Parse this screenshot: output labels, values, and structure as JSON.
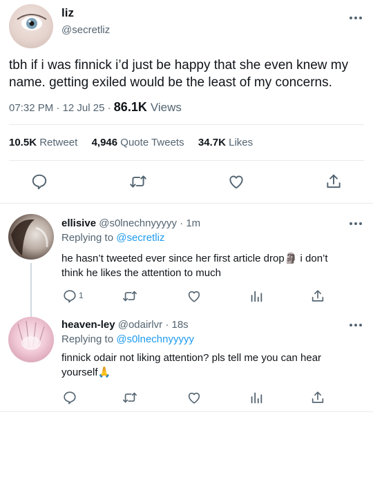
{
  "main_tweet": {
    "display_name": "liz",
    "handle": "@secretliz",
    "text_line1": "tbh if i was finnick i’d just be happy that she even knew my",
    "text_line2": "name. getting exiled would be the least of my concerns.",
    "time": "07:32 PM",
    "date": "12 Jul 25",
    "views_count": "86.1K",
    "views_label": "Views",
    "retweets_count": "10.5K",
    "retweets_label": "Retweet",
    "quotes_count": "4,946",
    "quotes_label": "Quote Tweets",
    "likes_count": "34.7K",
    "likes_label": "Likes"
  },
  "replies": [
    {
      "display_name": "ellisive",
      "handle": "@s0lnechnyyyyy",
      "time": "1m",
      "replying_label": "Replying to",
      "replying_to": "@secretliz",
      "text_line1": "he hasn’t tweeted ever since her first article drop🗿  i don’t",
      "text_line2": "think he likes the attention to much",
      "reply_count": "1"
    },
    {
      "display_name": "heaven-ley",
      "handle": "@odairlvr",
      "time": "18s",
      "replying_label": "Replying to",
      "replying_to": "@s0lnechnyyyyy",
      "text_line1": "finnick odair not liking attention? pls tell me you can hear",
      "text_line2": "yourself🙏",
      "reply_count": ""
    }
  ],
  "icons": [
    "reply-icon",
    "retweet-icon",
    "like-icon",
    "share-icon",
    "analytics-icon",
    "more-icon"
  ],
  "colors": {
    "link": "#1d9bf0",
    "secondary_text": "#536471",
    "divider": "#e6e9ec"
  }
}
